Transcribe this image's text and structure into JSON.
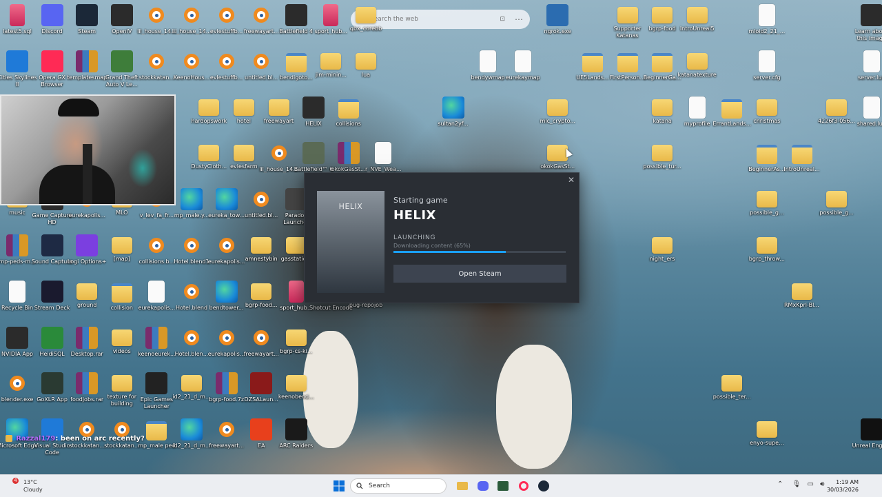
{
  "search": {
    "placeholder": "Search the web"
  },
  "icons": [
    {
      "label": "latest5.sql",
      "kind": "db",
      "col": 0,
      "row": 0
    },
    {
      "label": "Discord",
      "kind": "round",
      "color": "#5865f2",
      "col": 1,
      "row": 0
    },
    {
      "label": "Steam",
      "kind": "round",
      "color": "#1b2838",
      "col": 2,
      "row": 0
    },
    {
      "label": "OpenIV",
      "kind": "exe",
      "col": 3,
      "row": 0
    },
    {
      "label": "lil_house_14...",
      "kind": "blender",
      "col": 4,
      "row": 0
    },
    {
      "label": "lil_house_14...",
      "kind": "blender",
      "col": 5,
      "row": 0
    },
    {
      "label": "evlestuffb...",
      "kind": "blender",
      "col": 6,
      "row": 0
    },
    {
      "label": "freewayart...",
      "kind": "blender",
      "col": 7,
      "row": 0
    },
    {
      "label": "Battlefield 4",
      "kind": "exe",
      "col": 8,
      "row": 0
    },
    {
      "label": "sport_hub...",
      "kind": "db",
      "col": 9,
      "row": 0
    },
    {
      "label": "qbx_corebb",
      "kind": "folder",
      "col": 10,
      "row": 0
    },
    {
      "label": "ngrok.exe",
      "kind": "exe",
      "color": "#2b6cb0",
      "col": 15.5,
      "row": 0
    },
    {
      "label": "Supporter Katanas",
      "kind": "folder",
      "col": 17.5,
      "row": 0
    },
    {
      "label": "bgrp-food",
      "kind": "folder",
      "col": 18.5,
      "row": 0
    },
    {
      "label": "IntroUnreal5",
      "kind": "folder",
      "col": 19.5,
      "row": 0
    },
    {
      "label": "mloid2_21_...",
      "kind": "file",
      "col": 21.5,
      "row": 0
    },
    {
      "label": "Learn about this image",
      "kind": "round",
      "color": "#2b2b2b",
      "col": 24.5,
      "row": 0
    },
    {
      "label": "Cities Skylines II",
      "kind": "exe",
      "color": "#1f7ad8",
      "col": 0,
      "row": 1
    },
    {
      "label": "Opera GX Browser",
      "kind": "round",
      "color": "#ff2a55",
      "col": 1,
      "row": 1
    },
    {
      "label": "templatesmap",
      "kind": "rar",
      "col": 2,
      "row": 1
    },
    {
      "label": "Grand Theft Auto V Le...",
      "kind": "exe",
      "color": "#3e7d3a",
      "col": 3,
      "row": 1
    },
    {
      "label": "stockkatan...",
      "kind": "blender",
      "col": 4,
      "row": 1
    },
    {
      "label": "KeenoHous...",
      "kind": "blender",
      "col": 5,
      "row": 1
    },
    {
      "label": "evlestuffb...",
      "kind": "blender",
      "col": 6,
      "row": 1
    },
    {
      "label": "untitled.bl...",
      "kind": "blender",
      "col": 7,
      "row": 1
    },
    {
      "label": "bendigoto...",
      "kind": "folderx",
      "col": 8,
      "row": 1
    },
    {
      "label": "jim-minin...",
      "kind": "folder",
      "col": 9,
      "row": 1
    },
    {
      "label": "lua",
      "kind": "folder",
      "col": 10,
      "row": 1
    },
    {
      "label": "bendywmap",
      "kind": "file",
      "col": 13.5,
      "row": 1
    },
    {
      "label": "eurekaymap",
      "kind": "file",
      "col": 14.5,
      "row": 1
    },
    {
      "label": "UE5Lands...",
      "kind": "folderx",
      "col": 16.5,
      "row": 1
    },
    {
      "label": "FirstPerson...",
      "kind": "folderx",
      "col": 17.5,
      "row": 1
    },
    {
      "label": "BeginnerGa...",
      "kind": "folderx",
      "col": 18.5,
      "row": 1
    },
    {
      "label": "katanatexture",
      "kind": "folder",
      "col": 19.5,
      "row": 1
    },
    {
      "label": "server.cfg",
      "kind": "file",
      "col": 21.5,
      "row": 1
    },
    {
      "label": "server.lua",
      "kind": "file",
      "col": 24.5,
      "row": 1
    },
    {
      "label": "hardopswork",
      "kind": "folder",
      "col": 5.5,
      "row": 2
    },
    {
      "label": "hotel",
      "kind": "folder",
      "col": 6.5,
      "row": 2
    },
    {
      "label": "freewayart",
      "kind": "folder",
      "col": 7.5,
      "row": 2
    },
    {
      "label": "HELIX",
      "kind": "exe",
      "col": 8.5,
      "row": 2
    },
    {
      "label": "collisions",
      "kind": "folderx",
      "col": 9.5,
      "row": 2
    },
    {
      "label": "sultan2yf...",
      "kind": "edge",
      "col": 12.5,
      "row": 2
    },
    {
      "label": "mlc_crypto...",
      "kind": "folder",
      "col": 15.5,
      "row": 2
    },
    {
      "label": "katana",
      "kind": "folder",
      "col": 18.5,
      "row": 2
    },
    {
      "label": "myprofile",
      "kind": "file",
      "col": 19.5,
      "row": 2
    },
    {
      "label": "ErrantLands...",
      "kind": "folderx",
      "col": 20.5,
      "row": 2
    },
    {
      "label": "christmas",
      "kind": "folder",
      "col": 21.5,
      "row": 2
    },
    {
      "label": "4226f3-056...",
      "kind": "folder",
      "col": 23.5,
      "row": 2
    },
    {
      "label": "shared.lua",
      "kind": "file",
      "col": 24.5,
      "row": 2
    },
    {
      "label": "DustyCloth...",
      "kind": "folder",
      "col": 5.5,
      "row": 3
    },
    {
      "label": "evlesfarm",
      "kind": "folder",
      "col": 6.5,
      "row": 3
    },
    {
      "label": "lil_house_14...",
      "kind": "blender",
      "col": 7.5,
      "row": 3
    },
    {
      "label": "Battlefield™ 6",
      "kind": "exe",
      "color": "#5a6a55",
      "col": 8.5,
      "row": 3
    },
    {
      "label": "okokGasSt...",
      "kind": "rar",
      "col": 9.5,
      "row": 3
    },
    {
      "label": "r_NVE_Wea...",
      "kind": "file",
      "col": 10.5,
      "row": 3
    },
    {
      "label": "okokGasSt...",
      "kind": "folder",
      "col": 15.5,
      "row": 3
    },
    {
      "label": "possible_tur...",
      "kind": "folder",
      "col": 18.5,
      "row": 3
    },
    {
      "label": "BeginnerAs...",
      "kind": "folderx",
      "col": 21.5,
      "row": 3
    },
    {
      "label": "IntroUnreal...",
      "kind": "folderx",
      "col": 22.5,
      "row": 3
    },
    {
      "label": "music",
      "kind": "folder",
      "col": 0,
      "row": 4
    },
    {
      "label": "Game Capture HD",
      "kind": "exe",
      "col": 1,
      "row": 4
    },
    {
      "label": "eurekapolis...",
      "kind": "blender",
      "col": 2,
      "row": 4
    },
    {
      "label": "MLO",
      "kind": "folder",
      "col": 3,
      "row": 4
    },
    {
      "label": "v_lev_fa_fr...",
      "kind": "blender",
      "col": 4,
      "row": 4
    },
    {
      "label": "mp_male.y...",
      "kind": "edge",
      "col": 5,
      "row": 4
    },
    {
      "label": "eureka_tow...",
      "kind": "edge",
      "col": 6,
      "row": 4
    },
    {
      "label": "untitled.bl...",
      "kind": "blender",
      "col": 7,
      "row": 4
    },
    {
      "label": "Paradox Launcher",
      "kind": "exe",
      "color": "#444",
      "col": 8,
      "row": 4
    },
    {
      "label": "possible_g...",
      "kind": "folder",
      "col": 21.5,
      "row": 4
    },
    {
      "label": "possible_g...",
      "kind": "folder",
      "col": 23.5,
      "row": 4
    },
    {
      "label": "mp-peds-m...",
      "kind": "rar",
      "col": 0,
      "row": 5
    },
    {
      "label": "Sound Capture",
      "kind": "round",
      "color": "#1e2a44",
      "col": 1,
      "row": 5
    },
    {
      "label": "Logi Options+",
      "kind": "exe",
      "color": "#7b3fe0",
      "col": 2,
      "row": 5
    },
    {
      "label": "[map]",
      "kind": "folder",
      "col": 3,
      "row": 5
    },
    {
      "label": "collisions.b...",
      "kind": "blender",
      "col": 4,
      "row": 5
    },
    {
      "label": "Hotel.blend1",
      "kind": "blender",
      "col": 5,
      "row": 5
    },
    {
      "label": "eurekapolis...",
      "kind": "blender",
      "col": 6,
      "row": 5
    },
    {
      "label": "amnestybin",
      "kind": "folder",
      "col": 7,
      "row": 5
    },
    {
      "label": "gasstatio...",
      "kind": "folder",
      "col": 8,
      "row": 5
    },
    {
      "label": "night_ers",
      "kind": "folder",
      "col": 18.5,
      "row": 5
    },
    {
      "label": "bgrp_throw...",
      "kind": "folder",
      "col": 21.5,
      "row": 5
    },
    {
      "label": "Recycle Bin",
      "kind": "file",
      "col": 0,
      "row": 6
    },
    {
      "label": "Stream Deck",
      "kind": "round",
      "color": "#1a1a2e",
      "col": 1,
      "row": 6
    },
    {
      "label": "ground",
      "kind": "folder",
      "col": 2,
      "row": 6
    },
    {
      "label": "collision",
      "kind": "folderx",
      "col": 3,
      "row": 6
    },
    {
      "label": "eurekapolis...",
      "kind": "file",
      "col": 4,
      "row": 6
    },
    {
      "label": "Hotel.blend",
      "kind": "blender",
      "col": 5,
      "row": 6
    },
    {
      "label": "bendtower...",
      "kind": "edge",
      "col": 6,
      "row": 6
    },
    {
      "label": "bgrp-food...",
      "kind": "folder",
      "col": 7,
      "row": 6
    },
    {
      "label": "sport_hub...",
      "kind": "db",
      "col": 8,
      "row": 6
    },
    {
      "label": "Shotcut Encode",
      "kind": "exe",
      "col": 9,
      "row": 6
    },
    {
      "label": "pug-repojob",
      "kind": "folder",
      "col": 10,
      "row": 6
    },
    {
      "label": "RMxKpri-Bl...",
      "kind": "folder",
      "col": 22.5,
      "row": 6
    },
    {
      "label": "NVIDIA App",
      "kind": "exe",
      "color": "#2b2b2b",
      "col": 0,
      "row": 7
    },
    {
      "label": "HeidiSQL",
      "kind": "round",
      "color": "#2a8a3a",
      "col": 1,
      "row": 7
    },
    {
      "label": "Desktop.rar",
      "kind": "rar",
      "col": 2,
      "row": 7
    },
    {
      "label": "videos",
      "kind": "folder",
      "col": 3,
      "row": 7
    },
    {
      "label": "keenoeurek...",
      "kind": "rar",
      "col": 4,
      "row": 7
    },
    {
      "label": "Hotel.blen...",
      "kind": "blender",
      "col": 5,
      "row": 7
    },
    {
      "label": "eurekapolis...",
      "kind": "blender",
      "col": 6,
      "row": 7
    },
    {
      "label": "freewayart...",
      "kind": "blender",
      "col": 7,
      "row": 7
    },
    {
      "label": "bgrp-cs-ki...",
      "kind": "folder",
      "col": 8,
      "row": 7
    },
    {
      "label": "blender.exe",
      "kind": "blender",
      "col": 0,
      "row": 8
    },
    {
      "label": "GoXLR App",
      "kind": "exe",
      "color": "#2a3a32",
      "col": 1,
      "row": 8
    },
    {
      "label": "foodjobs.rar",
      "kind": "rar",
      "col": 2,
      "row": 8
    },
    {
      "label": "texture for building",
      "kind": "folder",
      "col": 3,
      "row": 8
    },
    {
      "label": "Epic Games Launcher",
      "kind": "exe",
      "color": "#222",
      "col": 4,
      "row": 8
    },
    {
      "label": "id2_21_d_m...",
      "kind": "folder",
      "col": 5,
      "row": 8
    },
    {
      "label": "bgrp-food.7z",
      "kind": "rar",
      "col": 6,
      "row": 8
    },
    {
      "label": "DZSALaun...",
      "kind": "exe",
      "color": "#8a1a1a",
      "col": 7,
      "row": 8
    },
    {
      "label": "keenobend...",
      "kind": "folder",
      "col": 8,
      "row": 8
    },
    {
      "label": "possible_ter...",
      "kind": "folder",
      "col": 20.5,
      "row": 8
    },
    {
      "label": "Microsoft Edge",
      "kind": "edge",
      "col": 0,
      "row": 9
    },
    {
      "label": "Visual Studio Code",
      "kind": "exe",
      "color": "#1f7ad8",
      "col": 1,
      "row": 9
    },
    {
      "label": "stockkatan...",
      "kind": "blender",
      "col": 2,
      "row": 9
    },
    {
      "label": "stockkatan...",
      "kind": "blender",
      "col": 3,
      "row": 9
    },
    {
      "label": "mp_male ped",
      "kind": "folderx",
      "col": 4,
      "row": 9
    },
    {
      "label": "id2_21_d_m...",
      "kind": "edge",
      "col": 5,
      "row": 9
    },
    {
      "label": "freewayart...",
      "kind": "blender",
      "col": 6,
      "row": 9
    },
    {
      "label": "EA",
      "kind": "round",
      "color": "#e8401c",
      "col": 7,
      "row": 9
    },
    {
      "label": "ARC Raiders",
      "kind": "exe",
      "color": "#1a1a1a",
      "col": 8,
      "row": 9
    },
    {
      "label": "enyo-supe...",
      "kind": "folder",
      "col": 21.5,
      "row": 9
    },
    {
      "label": "Unreal Engine",
      "kind": "round",
      "color": "#111",
      "col": 24.5,
      "row": 9
    }
  ],
  "dialog": {
    "capsule_text": "HELIX",
    "subtitle": "Starting game",
    "title": "HELIX",
    "status": "LAUNCHING",
    "detail": "Downloading content (65%)",
    "progress": 0.65,
    "button": "Open Steam",
    "close": "✕"
  },
  "chat": {
    "user": "Razzal179",
    "message": ": been on arc recently?"
  },
  "taskbar": {
    "temp": "13°C",
    "condition": "Cloudy",
    "weather_badge": "4",
    "search": "Search",
    "time": "1:19 AM",
    "date": "30/03/2026"
  }
}
